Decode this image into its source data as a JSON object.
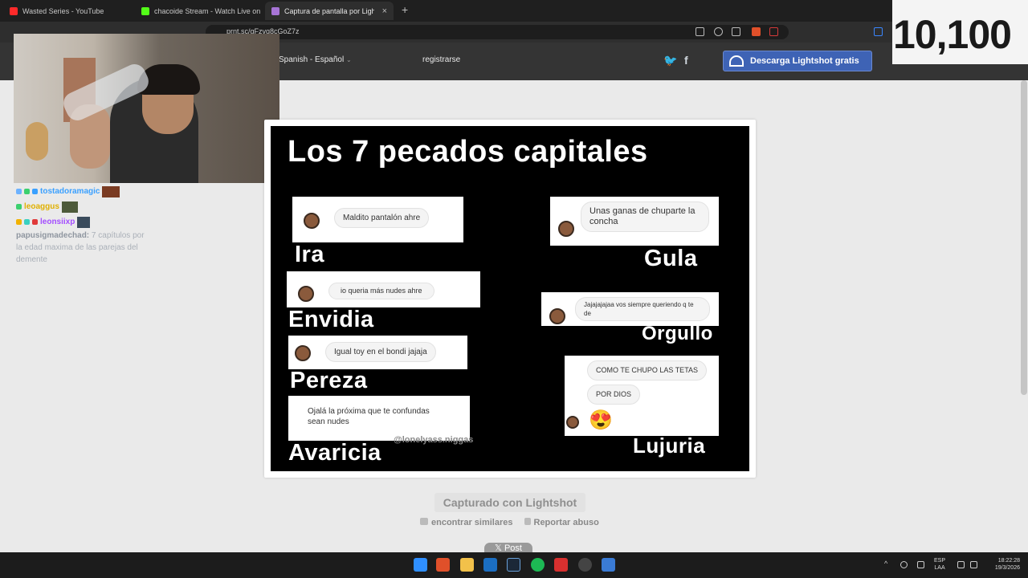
{
  "browser": {
    "tabs": [
      {
        "title": "Wasted Series - YouTube",
        "favicon_color": "#ff2a2a"
      },
      {
        "title": "chacoide Stream - Watch Live on",
        "favicon_color": "#53fc18"
      },
      {
        "title": "Captura de pantalla por Lightshot",
        "favicon_color": "#a774d6",
        "active": true
      }
    ],
    "url": "prnt.sc/gFzvq8cGoZ7z",
    "new_tab_glyph": "+",
    "close_glyph": "×"
  },
  "lightshot": {
    "language": "Spanish - Español",
    "register": "registrarse",
    "download_button": "Descarga Lightshot gratis",
    "captured_with": "Capturado con Lightshot",
    "find_similar": "encontrar similares",
    "report": "Reportar abuso",
    "post_button": "𝕏 Post"
  },
  "stream_overlay": {
    "counter": "10,100"
  },
  "chat": {
    "users": [
      {
        "name": "tostadoramagic",
        "color": "#3aa0ff"
      },
      {
        "name": "leoaggus",
        "color": "#e0b000"
      },
      {
        "name": "leonsiixp",
        "color": "#a34dff"
      }
    ],
    "message_user": "papusigmadechad:",
    "message_text": "7 capítulos por la edad maxima de las parejas del demente"
  },
  "meme": {
    "title": "Los 7 pecados capitales",
    "sins": {
      "ira": {
        "label": "Ira",
        "text": "Maldito pantalón ahre"
      },
      "envidia": {
        "label": "Envidia",
        "text": "io queria más nudes ahre"
      },
      "pereza": {
        "label": "Pereza",
        "text": "Igual toy en el bondi jajaja"
      },
      "avaricia": {
        "label": "Avaricia",
        "text": "Ojalá la próxima que te confundas sean nudes"
      },
      "gula": {
        "label": "Gula",
        "text": "Unas ganas de chuparte la concha"
      },
      "orgullo": {
        "label": "Orgullo",
        "text": "Jajajajajaa vos siempre queriendo q te de"
      },
      "lujuria": {
        "label": "Lujuria",
        "text1": "COMO TE CHUPO LAS TETAS",
        "text2": "POR DIOS",
        "emoji": "😍"
      }
    },
    "watermark": "@lonelyass.niggas"
  },
  "taskbar": {
    "language": "ESP",
    "language_sub": "LAA",
    "time": "18:22:28",
    "date": "19/3/2026"
  }
}
